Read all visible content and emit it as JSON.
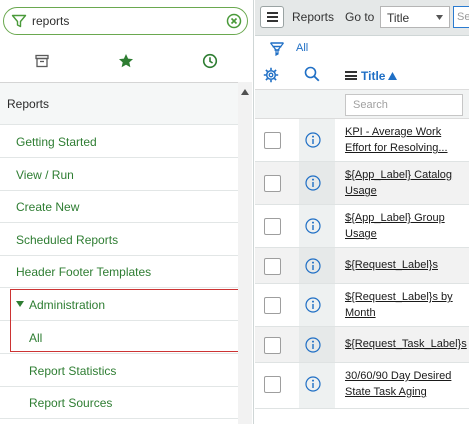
{
  "navigator": {
    "filter_text": "reports",
    "tabs": [
      {
        "name": "all-applications",
        "icon": "archive-icon"
      },
      {
        "name": "favorites",
        "icon": "star-icon"
      },
      {
        "name": "history",
        "icon": "clock-icon"
      }
    ],
    "section_label": "Reports",
    "items": [
      {
        "label": "Getting Started"
      },
      {
        "label": "View / Run"
      },
      {
        "label": "Create New"
      },
      {
        "label": "Scheduled Reports"
      },
      {
        "label": "Header Footer Templates"
      }
    ],
    "admin_label": "Administration",
    "admin_items": [
      {
        "label": "All"
      },
      {
        "label": "Report Statistics"
      },
      {
        "label": "Report Sources"
      }
    ]
  },
  "list": {
    "title": "Reports",
    "goto_label": "Go to",
    "goto_select_value": "Title",
    "goto_search_placeholder": "Se",
    "breadcrumb": "All",
    "column_title": "Title",
    "column_search_placeholder": "Search",
    "rows": [
      {
        "title_line1": "KPI - Average Work",
        "title_line2": "Effort for Resolving..."
      },
      {
        "title_line1": "${App_Label} Catalog",
        "title_line2": "Usage"
      },
      {
        "title_line1": "${App_Label} Group",
        "title_line2": "Usage"
      },
      {
        "title_line1": "${Request_Label}s",
        "title_line2": ""
      },
      {
        "title_line1": "${Request_Label}s by",
        "title_line2": "Month"
      },
      {
        "title_line1": "${Request_Task_Label}s",
        "title_line2": ""
      },
      {
        "title_line1": "30/60/90 Day Desired",
        "title_line2": "State Task Aging"
      }
    ]
  },
  "colors": {
    "nav_green": "#2e7d32",
    "filter_border": "#6aa84f",
    "link_blue": "#1f6fc5",
    "highlight_red": "#cc3333"
  }
}
